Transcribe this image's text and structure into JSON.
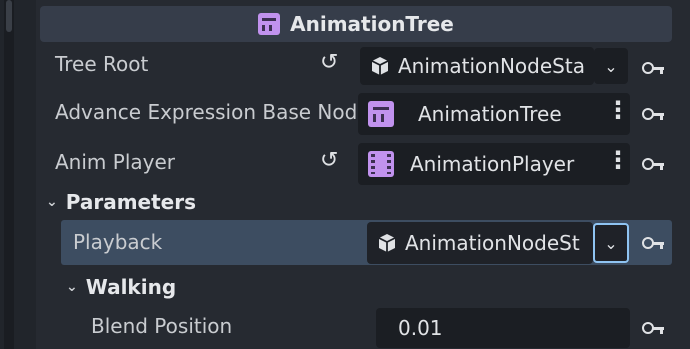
{
  "header": {
    "title": "AnimationTree",
    "icon": "animation-tree-icon"
  },
  "properties": [
    {
      "label": "Tree Root",
      "value": "AnimationNodeSta",
      "has_revert": true,
      "control": "dropdown"
    },
    {
      "label": "Advance Expression Base Nod",
      "value": "AnimationTree",
      "has_revert": false,
      "control": "menu"
    },
    {
      "label": "Anim Player",
      "value": "AnimationPlayer",
      "has_revert": true,
      "control": "menu"
    }
  ],
  "groups": {
    "parameters": {
      "title": "Parameters"
    },
    "walking": {
      "title": "Walking"
    }
  },
  "playback": {
    "label": "Playback",
    "value": "AnimationNodeSt"
  },
  "blend_position": {
    "label": "Blend Position",
    "value": "0.01"
  },
  "colors": {
    "accent": "#c192ee",
    "selected_row": "#3d4d61",
    "focus_border": "#8fc4f2"
  }
}
